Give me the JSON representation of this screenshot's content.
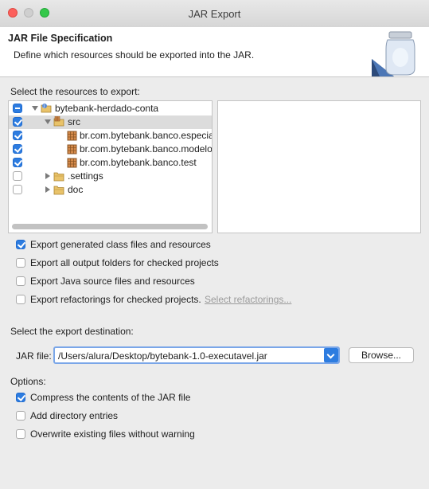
{
  "window": {
    "title": "JAR Export"
  },
  "header": {
    "title": "JAR File Specification",
    "description": "Define which resources should be exported into the JAR."
  },
  "resources": {
    "label": "Select the resources to export:",
    "tree": [
      {
        "label": "bytebank-herdado-conta",
        "check": "mixed",
        "expanded": true,
        "icon": "java-project-icon"
      },
      {
        "label": "src",
        "check": "checked",
        "expanded": true,
        "icon": "source-folder-icon",
        "selected": true
      },
      {
        "label": "br.com.bytebank.banco.especial",
        "check": "checked",
        "icon": "package-icon"
      },
      {
        "label": "br.com.bytebank.banco.modelo",
        "check": "checked",
        "icon": "package-icon"
      },
      {
        "label": "br.com.bytebank.banco.test",
        "check": "checked",
        "icon": "package-icon"
      },
      {
        "label": ".settings",
        "check": "unchecked",
        "expanded": false,
        "icon": "folder-icon"
      },
      {
        "label": "doc",
        "check": "unchecked",
        "expanded": false,
        "icon": "folder-icon"
      }
    ]
  },
  "export_options": [
    {
      "label": "Export generated class files and resources",
      "checked": true
    },
    {
      "label": "Export all output folders for checked projects",
      "checked": false
    },
    {
      "label": "Export Java source files and resources",
      "checked": false
    },
    {
      "label": "Export refactorings for checked projects.",
      "checked": false
    }
  ],
  "select_refactorings_link": "Select refactorings...",
  "destination": {
    "label": "Select the export destination:",
    "jar_file_label": "JAR file:",
    "jar_file_value": "/Users/alura/Desktop/bytebank-1.0-executavel.jar",
    "browse_label": "Browse..."
  },
  "options": {
    "label": "Options:",
    "items": [
      {
        "label": "Compress the contents of the JAR file",
        "checked": true
      },
      {
        "label": "Add directory entries",
        "checked": false
      },
      {
        "label": "Overwrite existing files without warning",
        "checked": false
      }
    ]
  },
  "colors": {
    "accent": "#2d7ce0",
    "link_disabled": "#9a9a9a"
  }
}
